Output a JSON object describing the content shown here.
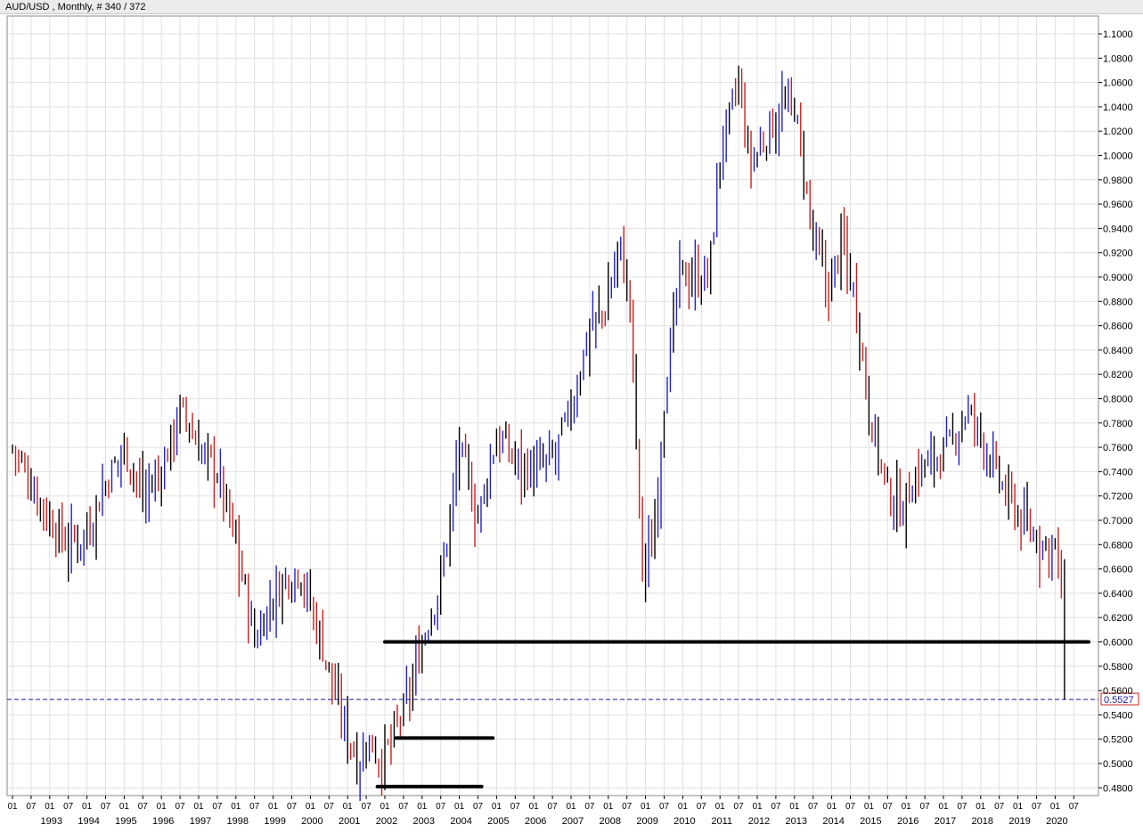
{
  "window": {
    "title": "AUD/USD , Monthly, # 340 / 372"
  },
  "colors": {
    "up": "#2222cc",
    "down": "#cc1f1f",
    "neutral": "#000000",
    "grid": "#e0e0e0",
    "current_price_line": "#1a1aa0",
    "price_tag_border": "#cc1f1f"
  },
  "chart_data": {
    "type": "ohlc",
    "title": "AUD/USD , Monthly, # 340 / 372",
    "ylim": [
      0.47,
      1.11
    ],
    "y_ticks": [
      "1.1000",
      "1.0800",
      "1.0600",
      "1.0400",
      "1.0200",
      "1.0000",
      "0.9800",
      "0.9600",
      "0.9400",
      "0.9200",
      "0.9000",
      "0.8800",
      "0.8600",
      "0.8400",
      "0.8200",
      "0.8000",
      "0.7800",
      "0.7600",
      "0.7400",
      "0.7200",
      "0.7000",
      "0.6800",
      "0.6600",
      "0.6400",
      "0.6200",
      "0.6000",
      "0.5800",
      "0.5600",
      "0.5400",
      "0.5200",
      "0.5000",
      "0.4800"
    ],
    "x_month_labels": [
      "01",
      "07",
      "01",
      "07",
      "01",
      "07",
      "01",
      "07",
      "01",
      "07",
      "01",
      "07",
      "01",
      "07",
      "01",
      "07",
      "01",
      "07",
      "01",
      "07",
      "01",
      "07",
      "01",
      "07",
      "01",
      "07",
      "01",
      "07",
      "01",
      "07",
      "01",
      "07",
      "01",
      "07",
      "01",
      "07",
      "01",
      "07",
      "01",
      "07",
      "01",
      "07",
      "01",
      "07",
      "01",
      "07",
      "01",
      "07",
      "01",
      "07",
      "01",
      "07",
      "01",
      "07",
      "01",
      "07",
      "01",
      "07"
    ],
    "x_year_labels": [
      "1993",
      "1994",
      "1995",
      "1996",
      "1997",
      "1998",
      "1999",
      "2000",
      "2001",
      "2002",
      "2003",
      "2004",
      "2005",
      "2006",
      "2007",
      "2008",
      "2009",
      "2010",
      "2011",
      "2012",
      "2013",
      "2014",
      "2015",
      "2016",
      "2017",
      "2018",
      "2019",
      "2020"
    ],
    "start_year": 1992,
    "anchors": [
      [
        1992.0,
        0.76
      ],
      [
        1992.5,
        0.73
      ],
      [
        1993.0,
        0.7
      ],
      [
        1993.5,
        0.68
      ],
      [
        1994.0,
        0.69
      ],
      [
        1994.5,
        0.73
      ],
      [
        1995.0,
        0.76
      ],
      [
        1995.5,
        0.72
      ],
      [
        1996.0,
        0.74
      ],
      [
        1996.5,
        0.79
      ],
      [
        1997.0,
        0.76
      ],
      [
        1997.5,
        0.74
      ],
      [
        1998.0,
        0.68
      ],
      [
        1998.5,
        0.6
      ],
      [
        1998.9,
        0.63
      ],
      [
        1999.3,
        0.65
      ],
      [
        1999.7,
        0.66
      ],
      [
        2000.3,
        0.6
      ],
      [
        2000.8,
        0.54
      ],
      [
        2001.3,
        0.5
      ],
      [
        2001.6,
        0.52
      ],
      [
        2001.9,
        0.5
      ],
      [
        2002.2,
        0.52
      ],
      [
        2002.6,
        0.55
      ],
      [
        2003.0,
        0.6
      ],
      [
        2003.5,
        0.65
      ],
      [
        2004.0,
        0.76
      ],
      [
        2004.5,
        0.7
      ],
      [
        2005.0,
        0.77
      ],
      [
        2005.5,
        0.75
      ],
      [
        2006.0,
        0.74
      ],
      [
        2006.5,
        0.75
      ],
      [
        2007.0,
        0.79
      ],
      [
        2007.5,
        0.86
      ],
      [
        2007.9,
        0.87
      ],
      [
        2008.3,
        0.93
      ],
      [
        2008.6,
        0.87
      ],
      [
        2008.9,
        0.66
      ],
      [
        2009.2,
        0.68
      ],
      [
        2009.5,
        0.8
      ],
      [
        2009.9,
        0.9
      ],
      [
        2010.3,
        0.9
      ],
      [
        2010.7,
        0.9
      ],
      [
        2011.0,
        1.0
      ],
      [
        2011.5,
        1.06
      ],
      [
        2011.8,
        0.99
      ],
      [
        2012.3,
        1.02
      ],
      [
        2012.7,
        1.04
      ],
      [
        2013.0,
        1.04
      ],
      [
        2013.5,
        0.93
      ],
      [
        2013.9,
        0.89
      ],
      [
        2014.3,
        0.93
      ],
      [
        2014.7,
        0.87
      ],
      [
        2015.0,
        0.79
      ],
      [
        2015.5,
        0.72
      ],
      [
        2015.9,
        0.71
      ],
      [
        2016.3,
        0.74
      ],
      [
        2016.7,
        0.75
      ],
      [
        2017.2,
        0.76
      ],
      [
        2017.6,
        0.79
      ],
      [
        2018.0,
        0.77
      ],
      [
        2018.5,
        0.73
      ],
      [
        2018.9,
        0.71
      ],
      [
        2019.3,
        0.69
      ],
      [
        2019.7,
        0.68
      ],
      [
        2020.0,
        0.68
      ],
      [
        2020.2,
        0.63
      ],
      [
        2020.25,
        0.5527
      ]
    ],
    "drawn_lines": [
      {
        "name": "support-0.60",
        "y": 0.6,
        "x_start": 2002.0,
        "x_end": 2020.9
      },
      {
        "name": "support-0.52",
        "y": 0.521,
        "x_start": 2002.3,
        "x_end": 2004.9
      },
      {
        "name": "support-0.48",
        "y": 0.481,
        "x_start": 2001.8,
        "x_end": 2004.6
      }
    ],
    "current_price": 0.5527,
    "current_price_label": "0.5527"
  }
}
